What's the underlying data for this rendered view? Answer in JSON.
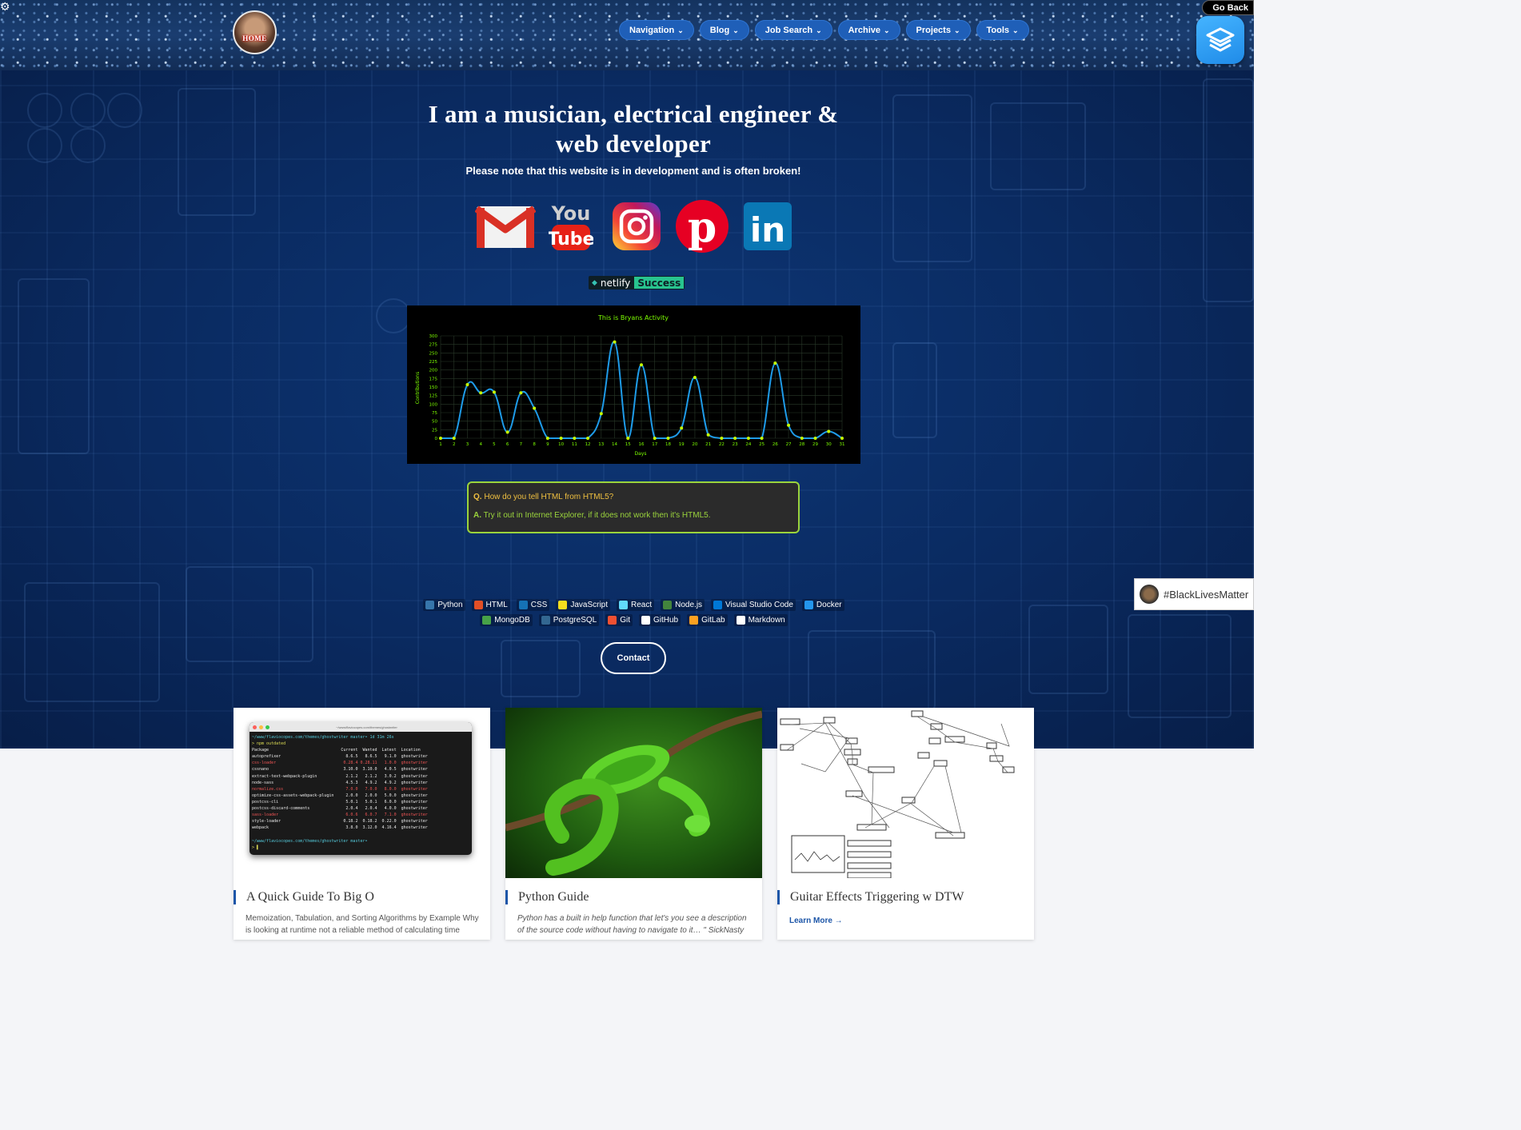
{
  "header": {
    "avatar_label": "HOME",
    "nav": [
      {
        "label": "Navigation"
      },
      {
        "label": "Blog"
      },
      {
        "label": "Job Search"
      },
      {
        "label": "Archive"
      },
      {
        "label": "Projects"
      },
      {
        "label": "Tools"
      }
    ],
    "go_back": "Go Back"
  },
  "hero": {
    "title": "I am a musician, electrical engineer & web developer",
    "subtitle": "Please note that this website is in development and is often broken!",
    "socials": [
      "gmail-icon",
      "youtube-icon",
      "instagram-icon",
      "pinterest-icon",
      "linkedin-icon"
    ],
    "netlify_label": "netlify",
    "netlify_status": "Success"
  },
  "chart_data": {
    "type": "line",
    "title": "This is Bryans Activity",
    "xlabel": "Days",
    "ylabel": "Contributions",
    "x": [
      1,
      2,
      3,
      4,
      5,
      6,
      7,
      8,
      9,
      10,
      11,
      12,
      13,
      14,
      15,
      16,
      17,
      18,
      19,
      20,
      21,
      22,
      23,
      24,
      25,
      26,
      27,
      28,
      29,
      30,
      31
    ],
    "values": [
      0,
      0,
      157,
      133,
      135,
      18,
      133,
      88,
      0,
      0,
      0,
      0,
      72,
      282,
      0,
      215,
      0,
      0,
      30,
      178,
      10,
      0,
      0,
      0,
      0,
      220,
      38,
      0,
      0,
      20,
      0
    ],
    "ylim": [
      0,
      300
    ],
    "yticks": [
      0,
      25,
      50,
      75,
      100,
      125,
      150,
      175,
      200,
      225,
      250,
      275,
      300
    ],
    "grid": true,
    "colors": {
      "line": "#1e9be8",
      "point": "#c6ff00",
      "text": "#7dff00",
      "grid": "#2a3a2a"
    }
  },
  "qa": {
    "q_prefix": "Q.",
    "q_text": "How do you tell HTML from HTML5?",
    "a_prefix": "A.",
    "a_text": "Try it out in Internet Explorer, if it does not work then it's HTML5."
  },
  "skills_row1": [
    {
      "label": "Python",
      "color": "#3776ab"
    },
    {
      "label": "HTML",
      "color": "#e34f26"
    },
    {
      "label": "CSS",
      "color": "#1572b6"
    },
    {
      "label": "JavaScript",
      "color": "#f7df1e"
    },
    {
      "label": "React",
      "color": "#61dafb"
    },
    {
      "label": "Node.js",
      "color": "#43853d"
    },
    {
      "label": "Visual Studio Code",
      "color": "#0078d7"
    },
    {
      "label": "Docker",
      "color": "#2496ed"
    }
  ],
  "skills_row2": [
    {
      "label": "MongoDB",
      "color": "#47a248"
    },
    {
      "label": "PostgreSQL",
      "color": "#336791"
    },
    {
      "label": "Git",
      "color": "#f05032"
    },
    {
      "label": "GitHub",
      "color": "#ffffff"
    },
    {
      "label": "GitLab",
      "color": "#fca121"
    },
    {
      "label": "Markdown",
      "color": "#ffffff"
    }
  ],
  "contact_label": "Contact",
  "blm_label": "#BlackLivesMatter",
  "cards": [
    {
      "title": "A Quick Guide To Big O",
      "desc": "Memoization, Tabulation, and Sorting Algorithms by Example Why is looking at runtime not a reliable method of calculating time"
    },
    {
      "title": "Python Guide",
      "desc": "Python has a built in help function that let's you see a description of the source code without having to navigate to it… \" SickNasty"
    },
    {
      "title": "Guitar Effects Triggering w DTW",
      "more": "Learn More →"
    }
  ],
  "terminal": {
    "path": "~/www/flaviocopes.com/themes/ghostwriter",
    "lines": [
      "~/www/flaviocopes.com/themes/ghostwriter master• 1d 31m 26s",
      "> npm outdated",
      "Package                              Current  Wanted  Latest  Location",
      "autoprefixer                           8.6.5   8.6.5   9.1.0  ghostwriter",
      "css-loader                            0.28.4 0.28.11   1.0.0  ghostwriter",
      "cssnano                               3.10.0  3.10.0   4.0.5  ghostwriter",
      "extract-text-webpack-plugin            2.1.2   2.1.2   3.0.2  ghostwriter",
      "node-sass                              4.5.3   4.9.2   4.9.2  ghostwriter",
      "normalize.css                          7.0.0   7.0.0   8.0.0  ghostwriter",
      "optimize-css-assets-webpack-plugin     2.0.0   2.0.0   5.0.0  ghostwriter",
      "postcss-cli                            5.0.1   5.0.1   6.0.0  ghostwriter",
      "postcss-discard-comments               2.0.4   2.0.4   4.0.0  ghostwriter",
      "sass-loader                            6.0.6   6.0.7   7.1.0  ghostwriter",
      "style-loader                          0.18.2  0.18.2  0.22.0  ghostwriter",
      "webpack                                3.8.0  3.12.0  4.16.4  ghostwriter",
      "",
      "~/www/flaviocopes.com/themes/ghostwriter master•",
      "> ▌"
    ]
  }
}
